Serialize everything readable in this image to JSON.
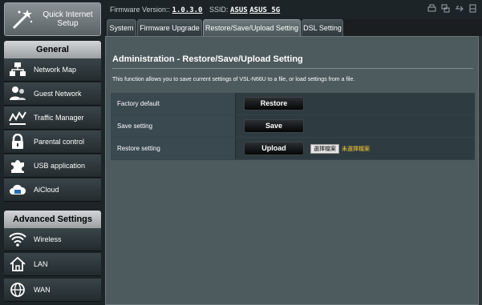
{
  "header": {
    "firmware_label": "Firmware Version::",
    "firmware_value": "1.0.3.0",
    "ssid_label": "SSID:",
    "ssid_value_1": "ASUS",
    "ssid_value_2": "ASUS_5G"
  },
  "sidebar": {
    "quick_setup": "Quick Internet Setup",
    "general_header": "General",
    "general_items": [
      {
        "label": "Network Map",
        "icon": "network-map-icon"
      },
      {
        "label": "Guest Network",
        "icon": "guest-network-icon"
      },
      {
        "label": "Traffic Manager",
        "icon": "traffic-manager-icon"
      },
      {
        "label": "Parental control",
        "icon": "lock-icon"
      },
      {
        "label": "USB application",
        "icon": "puzzle-icon"
      },
      {
        "label": "AiCloud",
        "icon": "cloud-icon"
      }
    ],
    "advanced_header": "Advanced Settings",
    "advanced_items": [
      {
        "label": "Wireless",
        "icon": "wifi-icon"
      },
      {
        "label": "LAN",
        "icon": "home-icon"
      },
      {
        "label": "WAN",
        "icon": "globe-icon"
      }
    ]
  },
  "tabs": [
    {
      "label": "System"
    },
    {
      "label": "Firmware Upgrade"
    },
    {
      "label": "Restore/Save/Upload Setting",
      "active": true
    },
    {
      "label": "DSL Setting"
    }
  ],
  "main": {
    "title": "Administration - Restore/Save/Upload Setting",
    "description": "This function allows you to save current settings of VSL-N66U to a file, or load settings from a file.",
    "rows": [
      {
        "label": "Factory default",
        "button": "Restore"
      },
      {
        "label": "Save setting",
        "button": "Save"
      },
      {
        "label": "Restore setting",
        "button": "Upload",
        "file_button": "選擇檔案",
        "file_status": "未選擇檔案"
      }
    ]
  },
  "colors": {
    "accent_yellow": "#ffcc33",
    "panel_bg": "#4d5a5e",
    "sidebar_bg": "#1c2427"
  }
}
